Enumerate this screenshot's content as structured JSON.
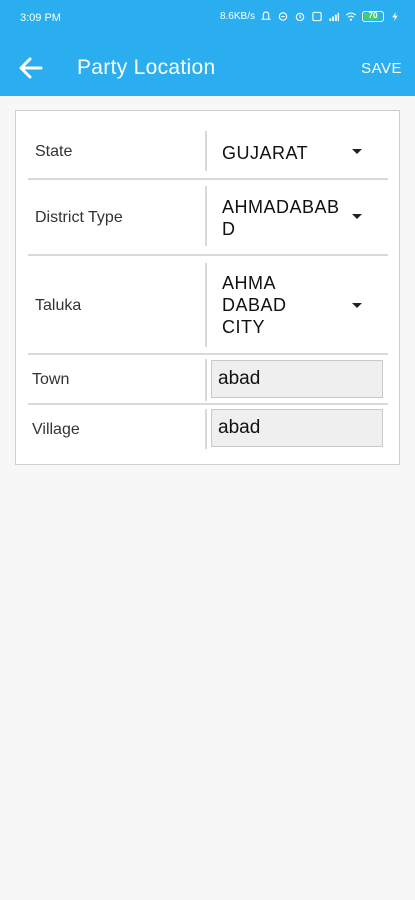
{
  "status_bar": {
    "time": "3:09 PM",
    "net_speed": "8.6KB/s",
    "battery": "70"
  },
  "toolbar": {
    "title": "Party Location",
    "save_label": "SAVE"
  },
  "form": {
    "state": {
      "label": "State",
      "value": "GUJARAT"
    },
    "district": {
      "label": "District Type",
      "value_lines": [
        "AHMADABAB",
        "D"
      ]
    },
    "taluka": {
      "label": "Taluka",
      "value_lines": [
        "AHMA",
        "DABAD",
        "CITY"
      ]
    },
    "town": {
      "label": "Town",
      "value": "abad"
    },
    "village": {
      "label": "Village",
      "value": "abad"
    }
  },
  "colors": {
    "app_bar": "#2aaef0",
    "background": "#f7f7f7"
  }
}
